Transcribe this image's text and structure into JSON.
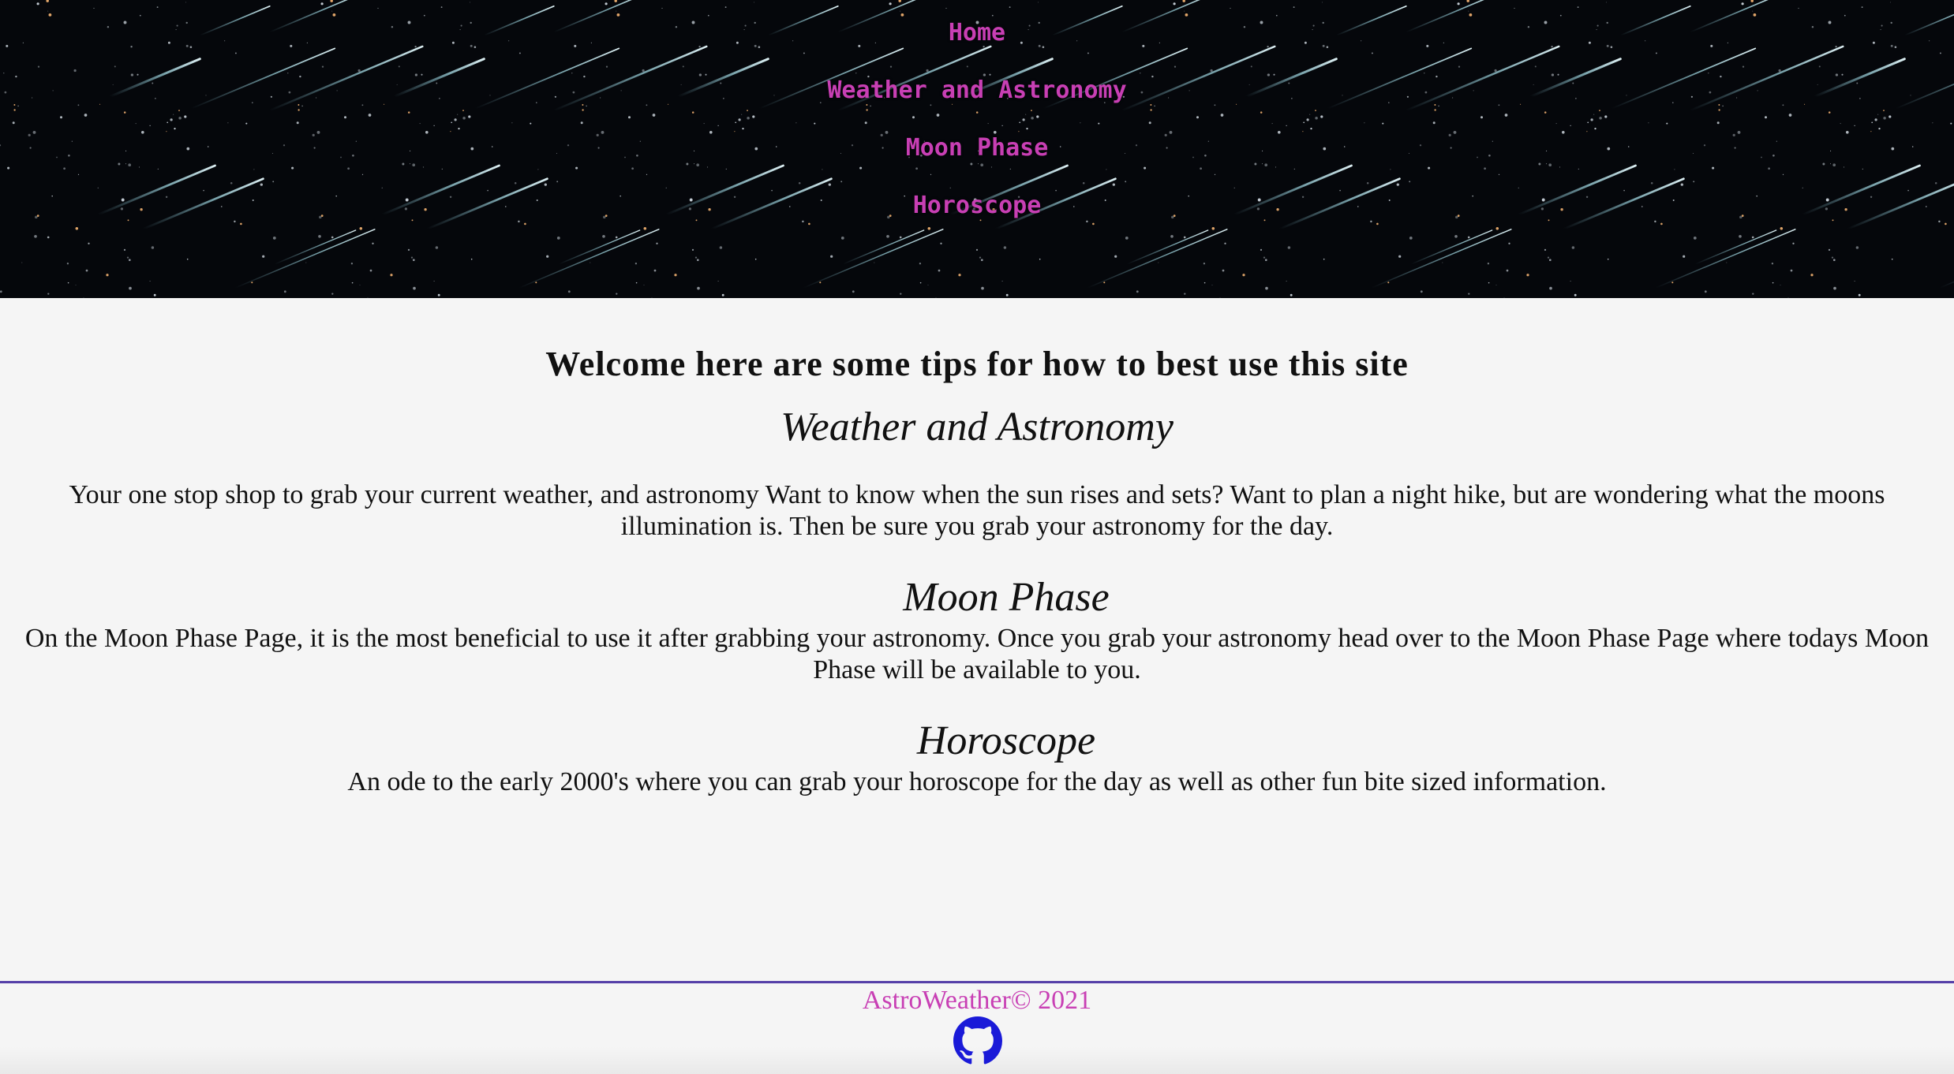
{
  "nav": {
    "items": [
      {
        "label": "Home"
      },
      {
        "label": "Weather and Astronomy"
      },
      {
        "label": "Moon Phase"
      },
      {
        "label": "Horoscope"
      }
    ]
  },
  "main": {
    "welcome": "Welcome here are some tips for how to best use this site",
    "sections": [
      {
        "title": "Weather and Astronomy",
        "text": "Your one stop shop to grab your current weather, and astronomy Want to know when the sun rises and sets? Want to plan a night hike, but are wondering what the moons illumination is. Then be sure you grab your astronomy for the day."
      },
      {
        "title": "Moon Phase",
        "text": "On the Moon Phase Page, it is the most beneficial to use it after grabbing your astronomy. Once you grab your astronomy head over to the Moon Phase Page where todays Moon Phase will be available to you."
      },
      {
        "title": "Horoscope",
        "text": "An ode to the early 2000's where you can grab your horoscope for the day as well as other fun bite sized information."
      }
    ]
  },
  "footer": {
    "copyright": "AstroWeather© 2021",
    "icon": "github-icon"
  },
  "colors": {
    "nav_link": "#c83fb4",
    "footer_text": "#c83fb4",
    "footer_rule": "#5540a8",
    "github_icon": "#1a1ad8",
    "page_background": "#f5f5f5",
    "header_background": "#05070b"
  }
}
